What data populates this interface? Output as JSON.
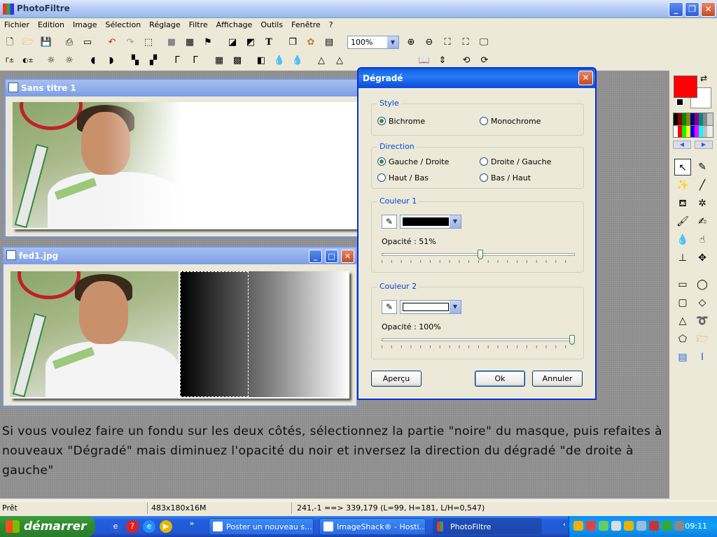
{
  "app": {
    "title": "PhotoFiltre"
  },
  "menu": [
    "Fichier",
    "Edition",
    "Image",
    "Sélection",
    "Réglage",
    "Filtre",
    "Affichage",
    "Outils",
    "Fenêtre",
    "?"
  ],
  "toolbar": {
    "zoom_value": "100%"
  },
  "windows": {
    "untitled": {
      "title": "Sans titre 1"
    },
    "fed1": {
      "title": "fed1.jpg"
    }
  },
  "dialog": {
    "title": "Dégradé",
    "style": {
      "label": "Style",
      "bichrome": "Bichrome",
      "monochrome": "Monochrome",
      "selected": "Bichrome"
    },
    "direction": {
      "label": "Direction",
      "left_right": "Gauche / Droite",
      "right_left": "Droite / Gauche",
      "top_bottom": "Haut / Bas",
      "bottom_top": "Bas / Haut",
      "selected": "Gauche / Droite"
    },
    "color1": {
      "label": "Couleur 1",
      "swatch": "#000000",
      "opacity_label": "Opacité : 51%",
      "opacity": 51
    },
    "color2": {
      "label": "Couleur 2",
      "swatch": "#ffffff",
      "opacity_label": "Opacité : 100%",
      "opacity": 100
    },
    "buttons": {
      "preview": "Aperçu",
      "ok": "Ok",
      "cancel": "Annuler"
    }
  },
  "palette": {
    "foreground": "#ff0000",
    "background": "#ffffff"
  },
  "tutorial": {
    "line1": "Si vous voulez faire un fondu sur les deux côtés, sélectionnez la partie \"noire\" du masque, puis refaites à",
    "line2": "nouveaux \"Dégradé\" mais diminuez l'opacité du noir et inversez la direction du dégradé \"de droite à gauche\""
  },
  "status": {
    "ready": "Prêt",
    "size": "483x180x16M",
    "coords": "241,-1 ==> 339,179 (L=99, H=181, L/H=0,547)"
  },
  "taskbar": {
    "start": "démarrer",
    "items": [
      "Poster un nouveau s...",
      "ImageShack® - Hosti...",
      "PhotoFiltre"
    ],
    "clock": "09:11"
  }
}
